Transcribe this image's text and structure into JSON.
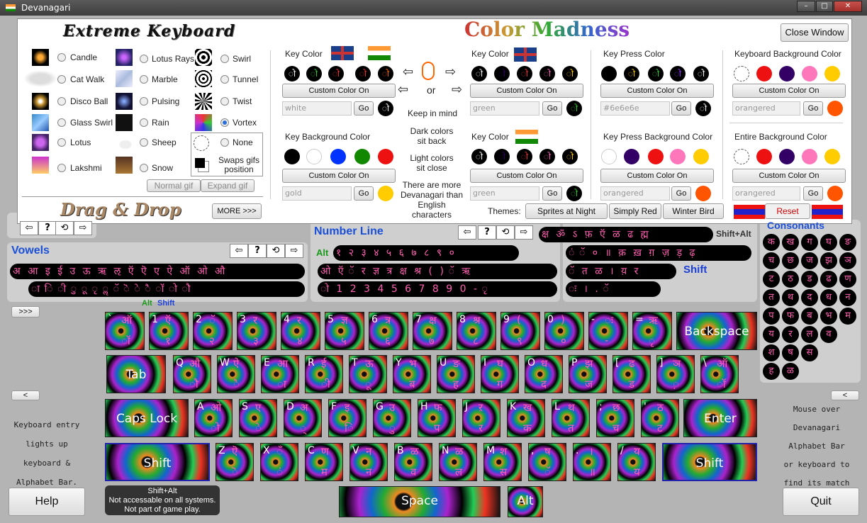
{
  "window": {
    "title": "Devanagari"
  },
  "panel": {
    "logo_title": "Extreme Keyboard",
    "header_title": "Color Madness",
    "close_label": "Close Window",
    "drag_drop": "Drag & Drop",
    "more_label": "MORE >>>",
    "normal_gif": "Normal gif",
    "expand_gif": "Expand gif",
    "swaps_label": "Swaps gifs position",
    "gifs_col1": [
      "Candle",
      "Cat Walk",
      "Disco Ball",
      "Glass Swirl",
      "Lotus",
      "Lakshmi"
    ],
    "gifs_col2": [
      "Lotus Rays",
      "Marble",
      "Pulsing",
      "Rain",
      "Sheep",
      "Snow"
    ],
    "gifs_col3": [
      "Swirl",
      "Tunnel",
      "Twist",
      "Vortex",
      "None"
    ],
    "key_color": {
      "title": "Key Color",
      "custom": "Custom Color On",
      "value": "white",
      "go": "Go"
    },
    "key_bg": {
      "title": "Key Background Color",
      "custom": "Custom Color On",
      "value": "gold",
      "go": "Go"
    },
    "mid": {
      "or": "or",
      "keep": "Keep in mind",
      "dark": "Dark colors sit back",
      "light": "Light colors sit close",
      "more": "There are more Devanagari than English characters"
    },
    "key_color2": {
      "title": "Key Color",
      "custom": "Custom Color On",
      "value": "green",
      "go": "Go"
    },
    "key_color3": {
      "title": "Key Color",
      "custom": "Custom Color On",
      "value": "green",
      "go": "Go"
    },
    "press_color": {
      "title": "Key Press Color",
      "custom": "Custom Color On",
      "value": "#6e6e6e",
      "go": "Go"
    },
    "press_bg": {
      "title": "Key Press Background Color",
      "custom": "Custom Color On",
      "value": "orangered",
      "go": "Go"
    },
    "kb_bg": {
      "title": "Keyboard Background Color",
      "custom": "Custom Color On",
      "value": "orangered",
      "go": "Go"
    },
    "entire_bg": {
      "title": "Entire Background Color",
      "custom": "Custom Color On",
      "value": "orangered",
      "go": "Go"
    },
    "themes_label": "Themes:",
    "themes": [
      "Sprites at Night",
      "Simply Red",
      "Winter Bird"
    ],
    "reset": "Reset"
  },
  "bars": {
    "number_line": "Number Line",
    "vowels": "Vowels",
    "consonants": "Consonants",
    "shift_alt": "Shift+Alt",
    "alt": "Alt",
    "shift": "Shift",
    "vowels_row1": "अ आ इ ई उ ऊ ऋ ऌ ऍ ऎ ए ऐ ऑ ओ औ",
    "vowels_row2": "ा ि ी ु ू ृ ॢ ॅ ॆ े ै ॉ ो ौ",
    "num_row1": "१ २ ३ ४ ५ ६ ७ ८ ९ ०",
    "num_row2": "ओ ऍ ॅ र ज्ञ त्र क्ष श्र ( ) ॅ ऋ",
    "num_row3": "ो 1 2 3 4 5 6 7 8 9 0 - ृ",
    "top_row": "क्ष ॐ ऽ फ़ ऍ ळ ढ ह्म",
    "mid_row1": "ं ॅ ० ॥ क़ ख़ ग़ ज़ ड़ ढ़",
    "mid_row2": "ॅ त ळ । य़ र",
    "mid_row3": "ः । . ॅ",
    "cons_rows": [
      [
        "क",
        "ख",
        "ग",
        "घ",
        "ङ"
      ],
      [
        "च",
        "छ",
        "ज",
        "झ",
        "ञ"
      ],
      [
        "ट",
        "ठ",
        "ड",
        "ढ",
        "ण"
      ],
      [
        "त",
        "थ",
        "द",
        "ध",
        "न"
      ],
      [
        "प",
        "फ",
        "ब",
        "भ",
        "म"
      ],
      [
        "य",
        "र",
        "ल",
        "व"
      ],
      [
        "श",
        "ष",
        "स"
      ],
      [
        "ह",
        "ळ"
      ]
    ]
  },
  "keyboard": {
    "more": ">>>",
    "left_arrow": "<",
    "alt_lbl": "Alt",
    "shift_lbl": "Shift",
    "row1": [
      [
        "`",
        "ऑ",
        "ॉ"
      ],
      [
        "1",
        "ऍ",
        "१"
      ],
      [
        "2",
        "ॅ",
        "२"
      ],
      [
        "3",
        "र",
        "३"
      ],
      [
        "4",
        "र",
        "४"
      ],
      [
        "5",
        "ज्ञ",
        "५"
      ],
      [
        "6",
        "त्र",
        "६"
      ],
      [
        "7",
        "क्ष",
        "७"
      ],
      [
        "8",
        "श्र",
        "८"
      ],
      [
        "9",
        "(",
        "९"
      ],
      [
        "0",
        ")",
        "०"
      ],
      [
        "-",
        "ः",
        "-"
      ],
      [
        "=",
        "ऋ",
        "ृ"
      ]
    ],
    "backspace": "Backspace",
    "tab": "Tab",
    "row2": [
      [
        "Q",
        "औ",
        "ौ"
      ],
      [
        "W",
        "ऐ",
        "ै"
      ],
      [
        "E",
        "आ",
        "ा"
      ],
      [
        "R",
        "ई",
        "ी"
      ],
      [
        "T",
        "ऊ",
        "ू"
      ],
      [
        "Y",
        "भ",
        "ब"
      ],
      [
        "U",
        "ङ",
        "ह"
      ],
      [
        "I",
        "घ",
        "ग"
      ],
      [
        "O",
        "ध",
        "द"
      ],
      [
        "P",
        "झ",
        "ज"
      ],
      [
        "[",
        "ढ",
        "ड"
      ],
      [
        "]",
        "ञ",
        "़"
      ],
      [
        "\\",
        "ऑ",
        "ॉ"
      ]
    ],
    "caps": "Caps Lock",
    "row3": [
      [
        "A",
        "ओ",
        "ो"
      ],
      [
        "S",
        "ए",
        "े"
      ],
      [
        "D",
        "अ",
        "्"
      ],
      [
        "F",
        "इ",
        "ि"
      ],
      [
        "G",
        "उ",
        "ु"
      ],
      [
        "H",
        "फ",
        "प"
      ],
      [
        "J",
        "ऱ",
        "र"
      ],
      [
        "K",
        "ख",
        "क"
      ],
      [
        "L",
        "थ",
        "त"
      ],
      [
        ";",
        "छ",
        "च"
      ],
      [
        "'",
        "ठ",
        "ट"
      ]
    ],
    "enter": "Enter",
    "shift": "Shift",
    "row4": [
      [
        "Z",
        "ऎ",
        "ॆ"
      ],
      [
        "X",
        "ँ",
        "ं"
      ],
      [
        "C",
        "ण",
        "म"
      ],
      [
        "V",
        "न",
        "न"
      ],
      [
        "B",
        "ळ",
        "व"
      ],
      [
        "N",
        "ळ",
        "ल"
      ],
      [
        "M",
        "श",
        "स"
      ],
      [
        ",",
        "ष",
        "ॅ"
      ],
      [
        ".",
        "।",
        "॥"
      ],
      [
        "/",
        "य",
        "य"
      ]
    ],
    "space": "Space",
    "alt": "Alt",
    "shiftalt_note": [
      "Shift+Alt",
      "Not accessable on all systems.",
      "Not part of game play."
    ]
  },
  "sidebar": {
    "left_text": [
      "Keyboard entry",
      "lights up",
      "keyboard &",
      "Alphabet Bar."
    ],
    "right_text": [
      "Mouse over",
      "Devanagari",
      "Alphabet Bar",
      "or keyboard to",
      "find its match"
    ],
    "help": "Help",
    "quit": "Quit",
    "left_arrow": "<"
  }
}
